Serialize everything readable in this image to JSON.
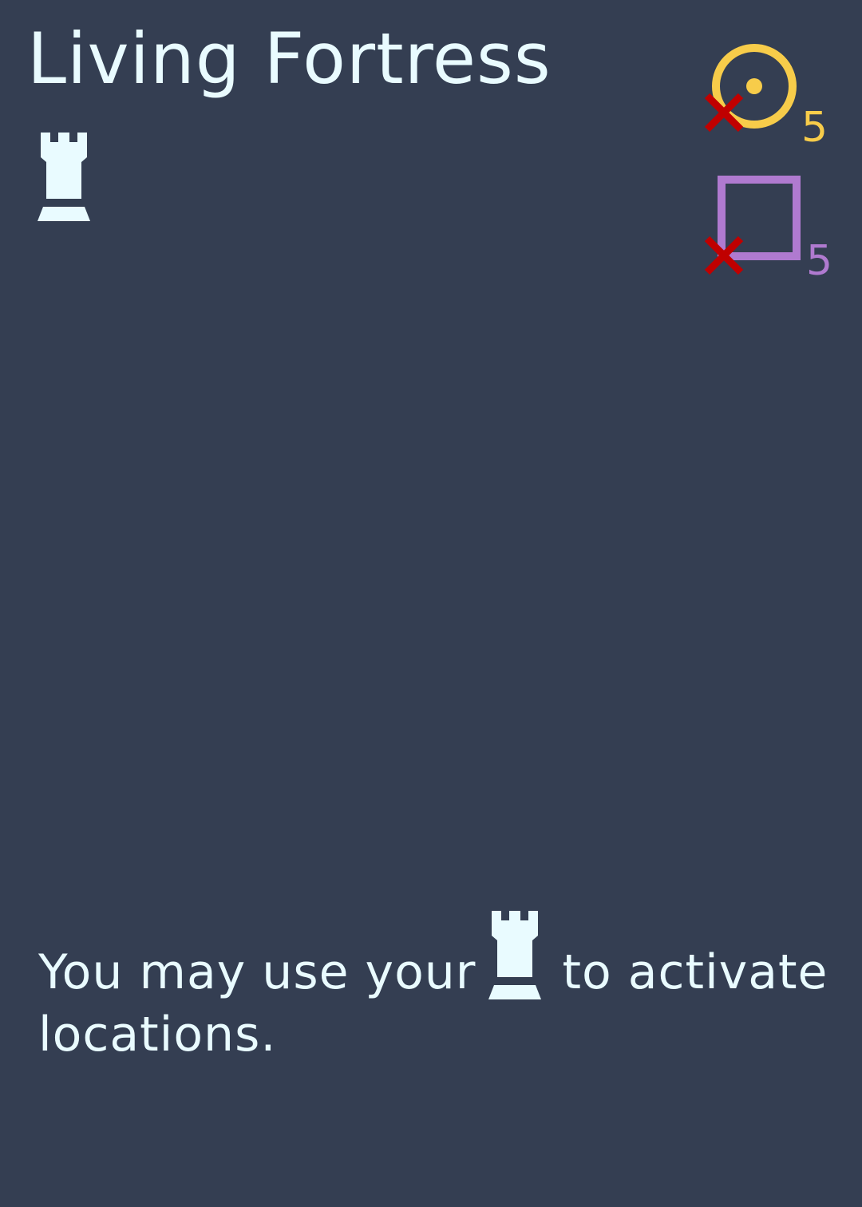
{
  "card": {
    "title": "Living Fortress",
    "type_icon": "rook-icon"
  },
  "costs": [
    {
      "shape": "circle-dot",
      "color": "#f7cc4a",
      "value": "5",
      "marker": "x-mark-icon",
      "marker_color": "#c00000"
    },
    {
      "shape": "square",
      "color": "#b07ad0",
      "value": "5",
      "marker": "x-mark-icon",
      "marker_color": "#c00000"
    }
  ],
  "ability": {
    "text_before": "You may use your",
    "icon": "rook-icon",
    "text_after": "to activate locations."
  },
  "colors": {
    "background": "#343e52",
    "text": "#e9fbff"
  }
}
